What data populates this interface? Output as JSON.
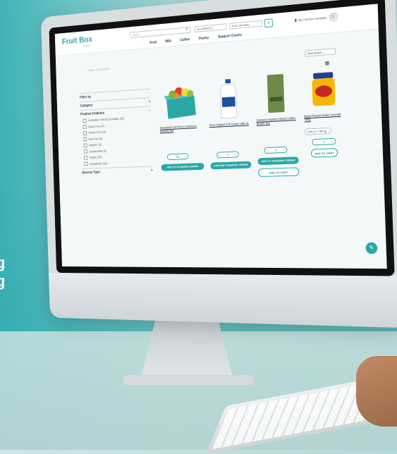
{
  "brand": {
    "logo": "Fruit Box",
    "tagline": "Group"
  },
  "header": {
    "search_placeholder": "Search",
    "selects": [
      "MC136423 S...",
      "Fruit 136 Wale..."
    ],
    "plus": "+",
    "account": "My Fruit Box Company",
    "nav": [
      "Fruit",
      "Milk",
      "Coffee",
      "Pantry",
      "Support Centre"
    ]
  },
  "breadcrumb": "Home > All Products",
  "sort": "Best Match",
  "sidebar": {
    "filter_title": "Filter by",
    "category": "Category",
    "category_toggle": "+",
    "features_title": "Product Features",
    "features_toggle": "−",
    "features": [
      "Australian Owned or Made (25)",
      "Dairy Free (6)",
      "Gluten Free (5)",
      "Nut Free (5)",
      "Organic (3)",
      "Sustainable (5)",
      "Vegan (24)",
      "Vegetarian (32)"
    ],
    "service_type": "Service Type",
    "service_toggle": "+"
  },
  "products": [
    {
      "title": "Seasonal Fruit Piece (minimum quantity 50)",
      "qty": "50",
      "button": "ADD TO STANDING ORDER"
    },
    {
      "title": "Pura Original Full Cream Milk 2L",
      "qty": "0",
      "button": "CHOOSE STANDING ORDER"
    },
    {
      "title": "Campos Superior Blend Coffee Beans 1kg",
      "qty": "0",
      "button": "ADD TO STANDING ORDER",
      "button2": "ADD TO CART"
    },
    {
      "title": "Bega Peanut Butter Smooth 780g",
      "variant": "Unit (1 x 780 g)",
      "qty": "1",
      "button2": "ADD TO CART"
    }
  ],
  "side_text": [
    "g",
    "g"
  ],
  "colors": {
    "accent": "#2aa7a7",
    "background_teal": "#2aa1a6"
  }
}
